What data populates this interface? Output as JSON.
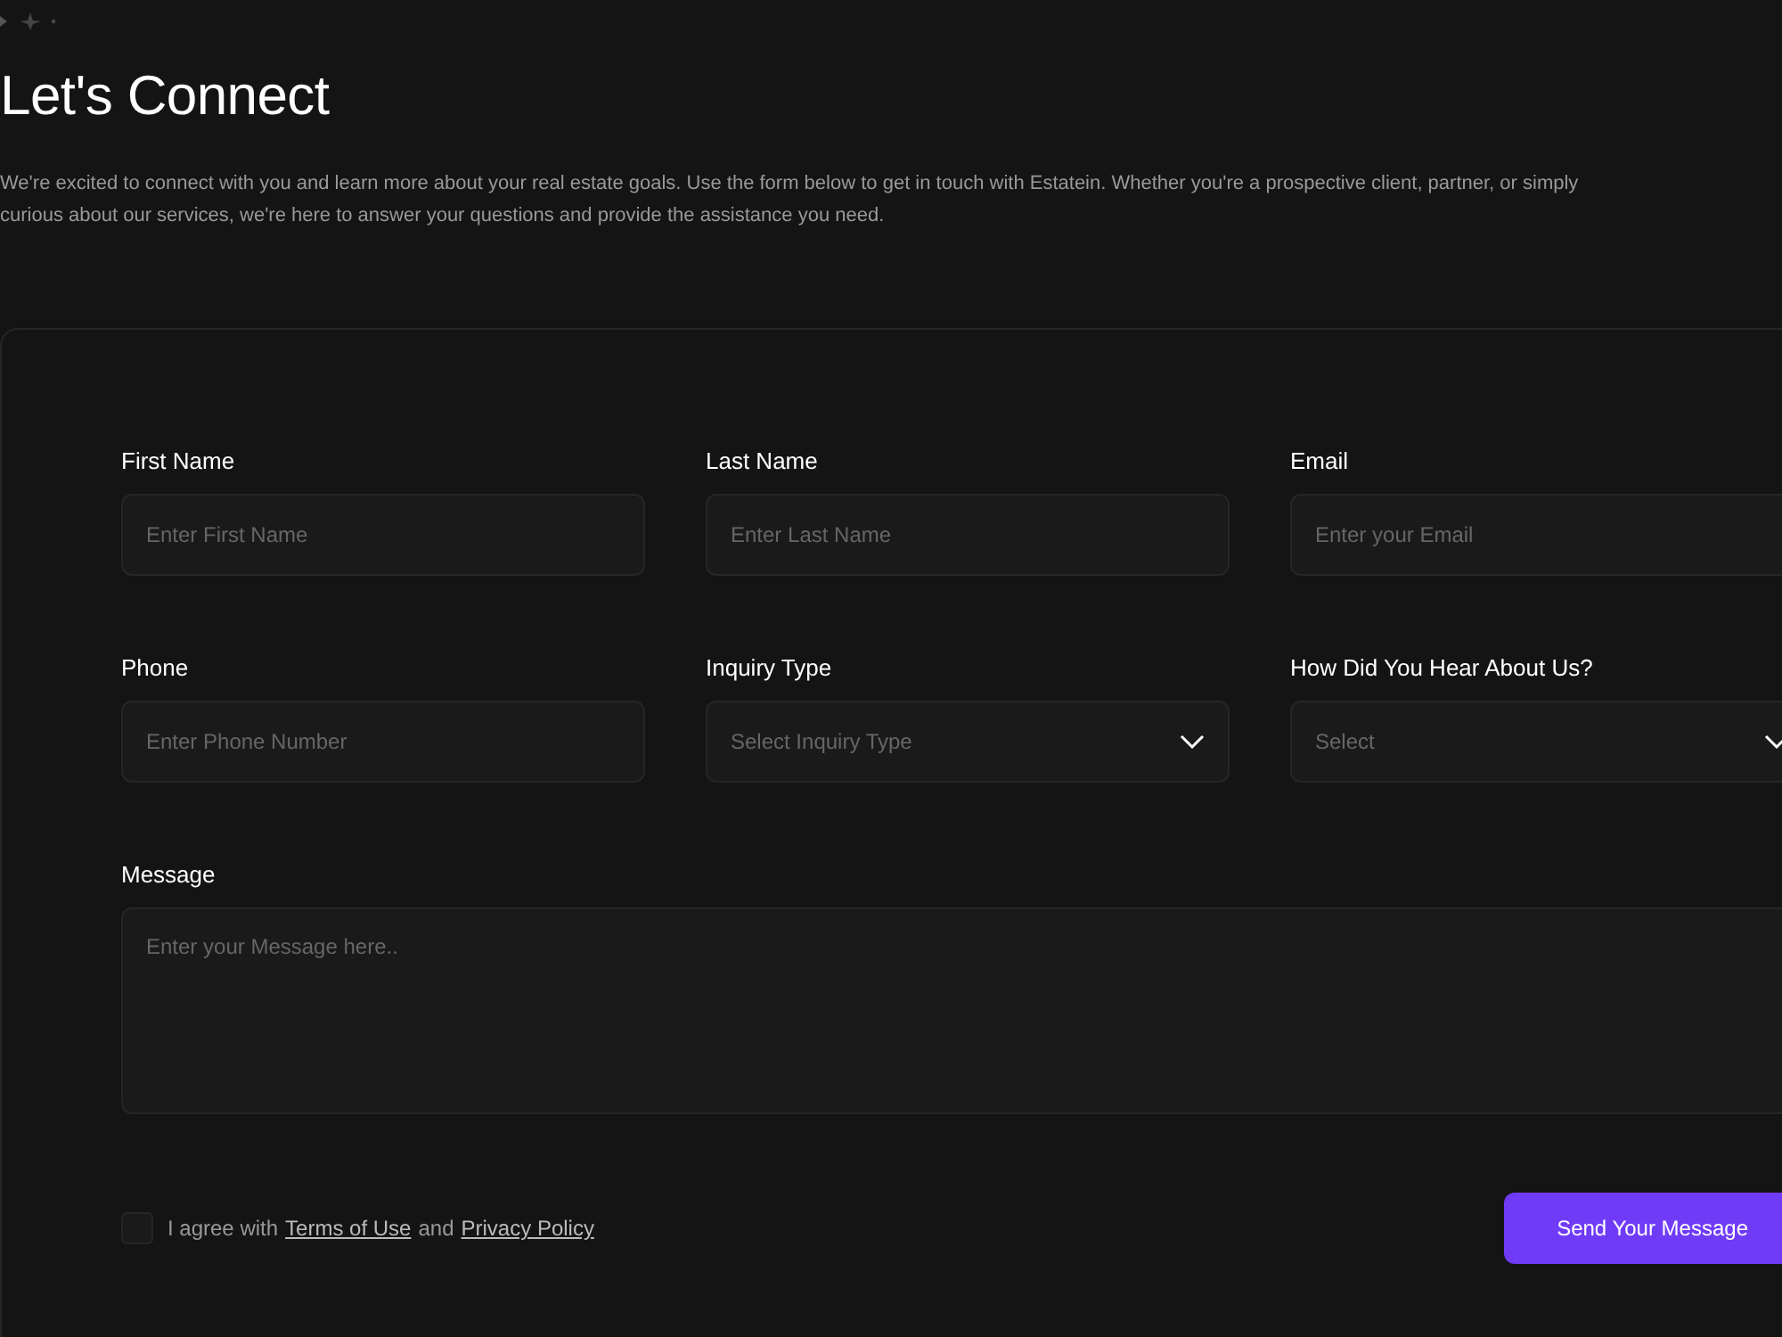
{
  "title": "Let's Connect",
  "intro": "We're excited to connect with you and learn more about your real estate goals. Use the form below to get in touch with Estatein. Whether you're a prospective client, partner, or simply curious about our services, we're here to answer your questions and provide the assistance you need.",
  "form": {
    "fields": [
      {
        "label": "First Name",
        "kind": "input",
        "placeholder": "Enter First Name"
      },
      {
        "label": "Last Name",
        "kind": "input",
        "placeholder": "Enter Last Name"
      },
      {
        "label": "Email",
        "kind": "input",
        "placeholder": "Enter your Email"
      },
      {
        "label": "Phone",
        "kind": "input",
        "placeholder": "Enter Phone Number"
      },
      {
        "label": "Inquiry Type",
        "kind": "select",
        "placeholder": "Select Inquiry Type"
      },
      {
        "label": "How Did You Hear About Us?",
        "kind": "select",
        "placeholder": "Select"
      },
      {
        "label": "Message",
        "kind": "textarea",
        "placeholder": "Enter your Message here.."
      }
    ],
    "agreement": {
      "checked": false,
      "text": "I agree with",
      "terms_link": "Terms of Use",
      "joiner": "and",
      "privacy_link": "Privacy Policy"
    },
    "submit": "Send Your Message"
  }
}
